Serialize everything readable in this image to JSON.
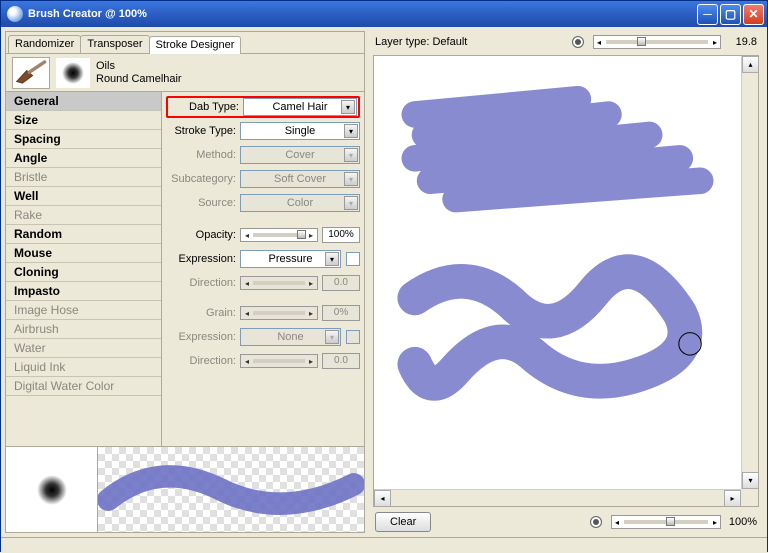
{
  "titlebar": {
    "title": "Brush Creator @ 100%"
  },
  "tabs": {
    "randomizer": "Randomizer",
    "transposer": "Transposer",
    "stroke_designer": "Stroke Designer"
  },
  "brush_header": {
    "category": "Oils",
    "variant": "Round Camelhair"
  },
  "categories": {
    "items": [
      {
        "label": "General",
        "bold": true,
        "sel": true
      },
      {
        "label": "Size",
        "bold": true
      },
      {
        "label": "Spacing",
        "bold": true
      },
      {
        "label": "Angle",
        "bold": true
      },
      {
        "label": "Bristle",
        "dim": true
      },
      {
        "label": "Well",
        "bold": true
      },
      {
        "label": "Rake",
        "dim": true
      },
      {
        "label": "Random",
        "bold": true
      },
      {
        "label": "Mouse",
        "bold": true
      },
      {
        "label": "Cloning",
        "bold": true
      },
      {
        "label": "Impasto",
        "bold": true
      },
      {
        "label": "Image Hose",
        "dim": true
      },
      {
        "label": "Airbrush",
        "dim": true
      },
      {
        "label": "Water",
        "dim": true
      },
      {
        "label": "Liquid Ink",
        "dim": true
      },
      {
        "label": "Digital Water Color",
        "dim": true
      }
    ]
  },
  "props": {
    "dab_type_label": "Dab Type:",
    "dab_type_value": "Camel Hair",
    "stroke_type_label": "Stroke Type:",
    "stroke_type_value": "Single",
    "method_label": "Method:",
    "method_value": "Cover",
    "subcategory_label": "Subcategory:",
    "subcategory_value": "Soft Cover",
    "source_label": "Source:",
    "source_value": "Color",
    "opacity_label": "Opacity:",
    "opacity_value": "100%",
    "expression1_label": "Expression:",
    "expression1_value": "Pressure",
    "direction1_label": "Direction:",
    "direction1_value": "0.0",
    "grain_label": "Grain:",
    "grain_value": "0%",
    "expression2_label": "Expression:",
    "expression2_value": "None",
    "direction2_label": "Direction:",
    "direction2_value": "0.0"
  },
  "right_panel": {
    "layer_type_label": "Layer type: Default",
    "slider_value": "19.8",
    "clear_btn": "Clear",
    "zoom_value": "100%"
  },
  "colors": {
    "brush_stroke": "#6e72c5"
  }
}
